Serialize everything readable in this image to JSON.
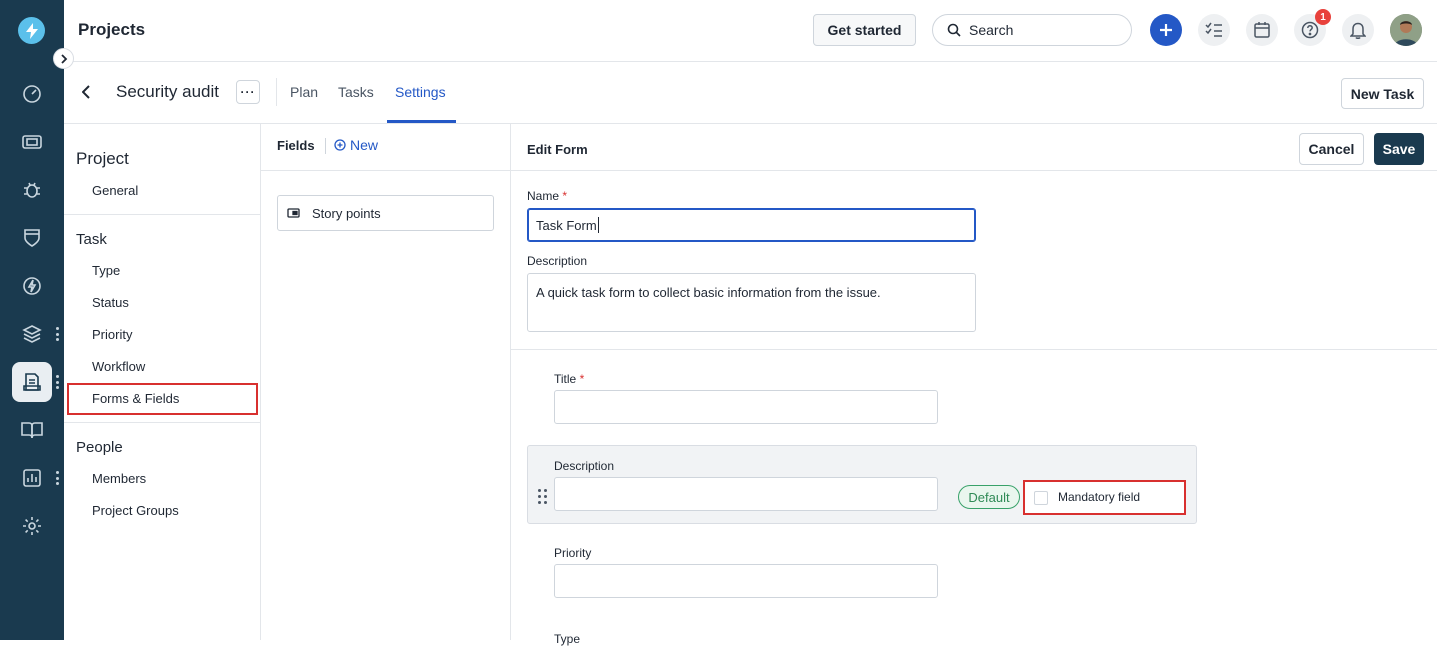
{
  "app": {
    "title": "Projects"
  },
  "topbar": {
    "get_started": "Get started",
    "search_label": "Search",
    "help_badge": "1"
  },
  "project": {
    "name": "Security audit",
    "tabs": [
      {
        "label": "Plan",
        "active": false
      },
      {
        "label": "Tasks",
        "active": false
      },
      {
        "label": "Settings",
        "active": true
      }
    ],
    "new_task": "New Task"
  },
  "settings_nav": {
    "groups": [
      {
        "label": "Project",
        "items": [
          "General"
        ]
      },
      {
        "label": "Task",
        "items": [
          "Type",
          "Status",
          "Priority",
          "Workflow",
          "Forms & Fields"
        ]
      },
      {
        "label": "People",
        "items": [
          "Members",
          "Project Groups"
        ]
      }
    ],
    "selected": "Forms & Fields"
  },
  "fields_panel": {
    "title": "Fields",
    "new_label": "New",
    "items": [
      "Story points"
    ]
  },
  "edit_form": {
    "title": "Edit Form",
    "cancel": "Cancel",
    "save": "Save",
    "name_label": "Name",
    "name_value": "Task Form",
    "description_label": "Description",
    "description_value": "A quick task form to collect basic information from the issue.",
    "required_mark": "*",
    "form_fields": [
      {
        "label": "Title",
        "required": true
      },
      {
        "label": "Description",
        "required": false,
        "badge": "Default",
        "mandatory_label": "Mandatory field",
        "mandatory_checked": false
      },
      {
        "label": "Priority",
        "required": false
      },
      {
        "label": "Type",
        "required": false
      }
    ]
  },
  "colors": {
    "rail": "#1a3a4f",
    "accent": "#2458c6",
    "highlight": "#d8302f",
    "default_pill": "#38a169"
  }
}
